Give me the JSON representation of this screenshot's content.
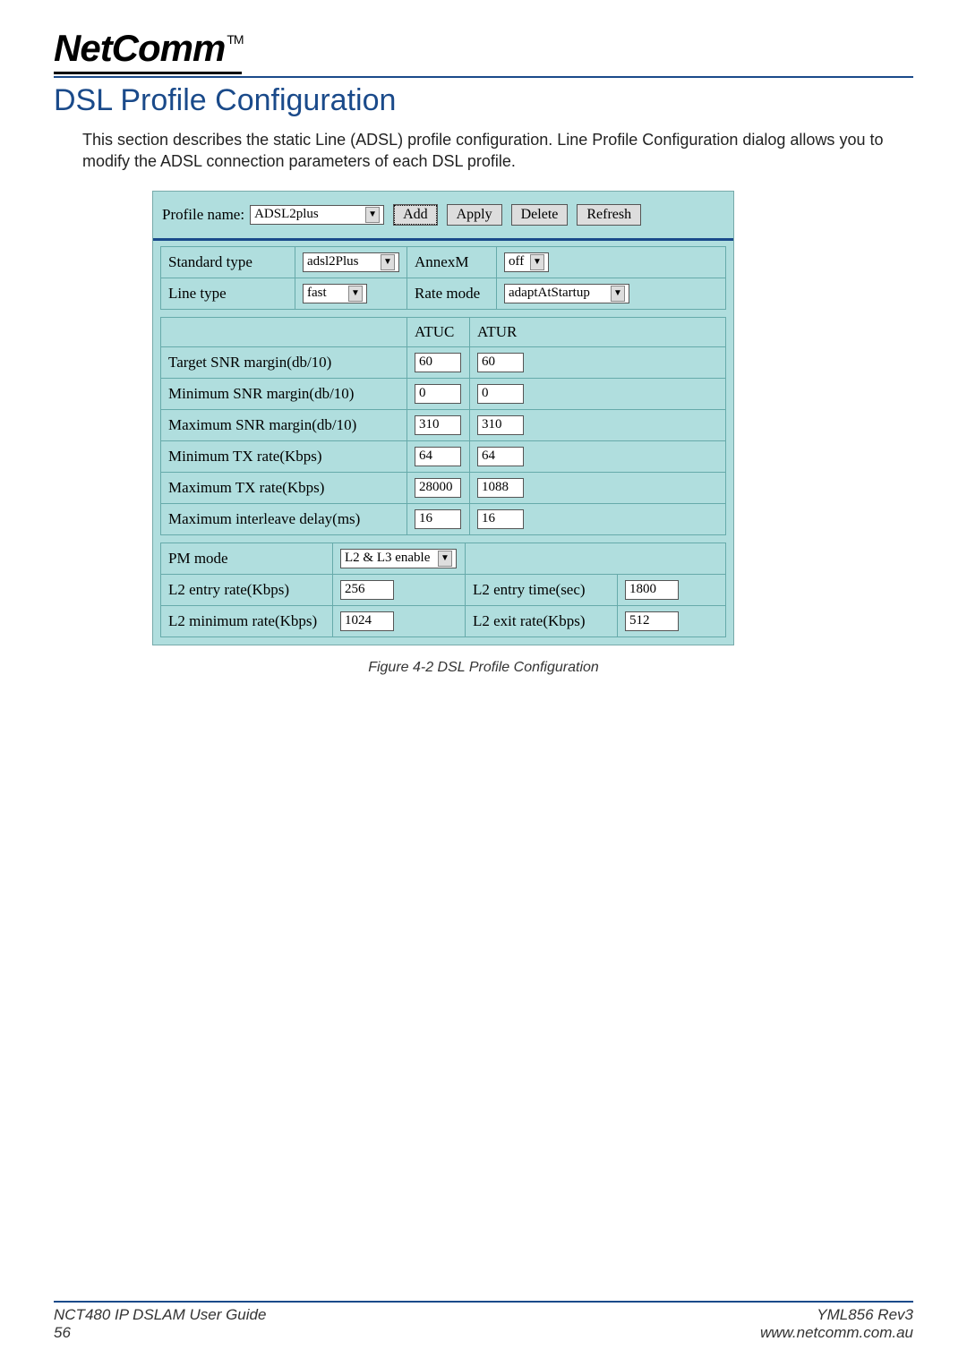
{
  "logo": {
    "text": "NetComm",
    "tm": "TM"
  },
  "title": "DSL Profile Configuration",
  "intro": "This section describes the static Line (ADSL) profile configuration. Line Profile Configuration dialog allows you to modify the ADSL connection parameters of each DSL profile.",
  "toolbar": {
    "profile_name_label": "Profile name:",
    "profile_name_value": "ADSL2plus",
    "add": "Add",
    "apply": "Apply",
    "delete": "Delete",
    "refresh": "Refresh"
  },
  "row1": {
    "std_label": "Standard type",
    "std_value": "adsl2Plus",
    "annexm_label": "AnnexM",
    "annexm_value": "off",
    "line_label": "Line type",
    "line_value": "fast",
    "rate_label": "Rate mode",
    "rate_value": "adaptAtStartup"
  },
  "snr_headers": {
    "atuc": "ATUC",
    "atur": "ATUR"
  },
  "snr_rows": [
    {
      "label": "Target SNR margin(db/10)",
      "atuc": "60",
      "atur": "60"
    },
    {
      "label": "Minimum SNR margin(db/10)",
      "atuc": "0",
      "atur": "0"
    },
    {
      "label": "Maximum SNR margin(db/10)",
      "atuc": "310",
      "atur": "310"
    },
    {
      "label": "Minimum TX rate(Kbps)",
      "atuc": "64",
      "atur": "64"
    },
    {
      "label": "Maximum TX rate(Kbps)",
      "atuc": "28000",
      "atur": "1088"
    },
    {
      "label": "Maximum interleave delay(ms)",
      "atuc": "16",
      "atur": "16"
    }
  ],
  "pm": {
    "mode_label": "PM mode",
    "mode_value": "L2 & L3 enable",
    "l2_entry_rate_label": "L2 entry rate(Kbps)",
    "l2_entry_rate_value": "256",
    "l2_entry_time_label": "L2 entry time(sec)",
    "l2_entry_time_value": "1800",
    "l2_min_rate_label": "L2 minimum rate(Kbps)",
    "l2_min_rate_value": "1024",
    "l2_exit_rate_label": "L2 exit rate(Kbps)",
    "l2_exit_rate_value": "512"
  },
  "figure_caption": "Figure 4-2 DSL Profile Configuration",
  "footer": {
    "guide": "NCT480 IP DSLAM User Guide",
    "page": "56",
    "rev": "YML856 Rev3",
    "url": "www.netcomm.com.au"
  }
}
